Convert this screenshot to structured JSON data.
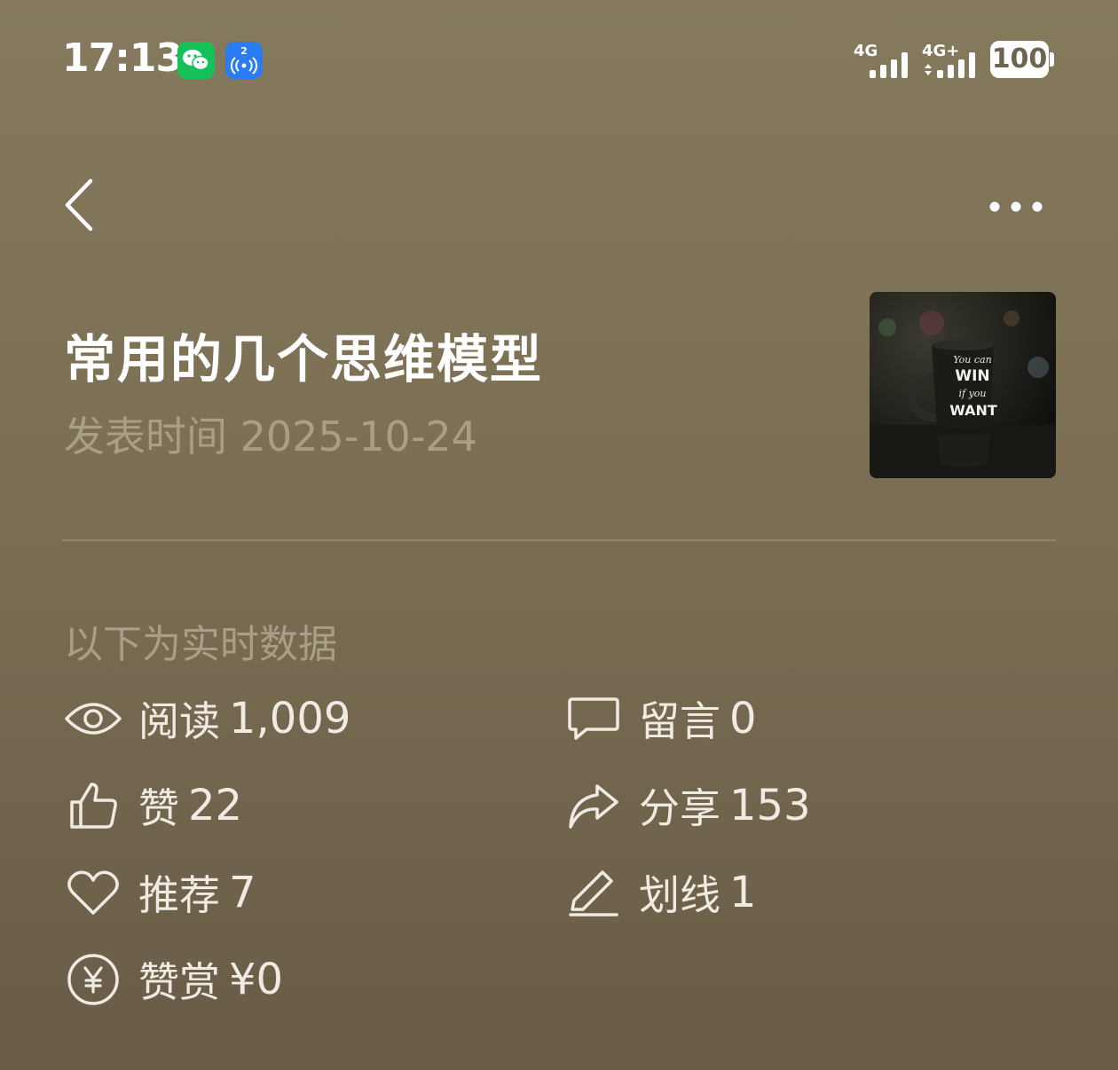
{
  "status_bar": {
    "time": "17:13",
    "hotspot_count": "2",
    "signal1": "4G",
    "signal2": "4G+",
    "battery": "100"
  },
  "icons": {
    "back": "back-chevron-icon",
    "more": "more-dots-icon"
  },
  "article": {
    "title": "常用的几个思维模型",
    "date": "发表时间 2025-10-24",
    "thumbnail_text": [
      "You can",
      "WIN",
      "if you",
      "WANT"
    ]
  },
  "section_label": "以下为实时数据",
  "stats": {
    "read": {
      "label": "阅读",
      "value": "1,009"
    },
    "comment": {
      "label": "留言",
      "value": "0"
    },
    "like": {
      "label": "赞",
      "value": "22"
    },
    "share": {
      "label": "分享",
      "value": "153"
    },
    "recommend": {
      "label": "推荐",
      "value": "7"
    },
    "underline": {
      "label": "划线",
      "value": "1"
    },
    "tip": {
      "label": "赞赏",
      "value": "¥0"
    }
  },
  "colors": {
    "background_top": "#857a5d",
    "background_bottom": "#685c47",
    "text_primary": "#ffffff",
    "text_muted": "#a99e86"
  }
}
